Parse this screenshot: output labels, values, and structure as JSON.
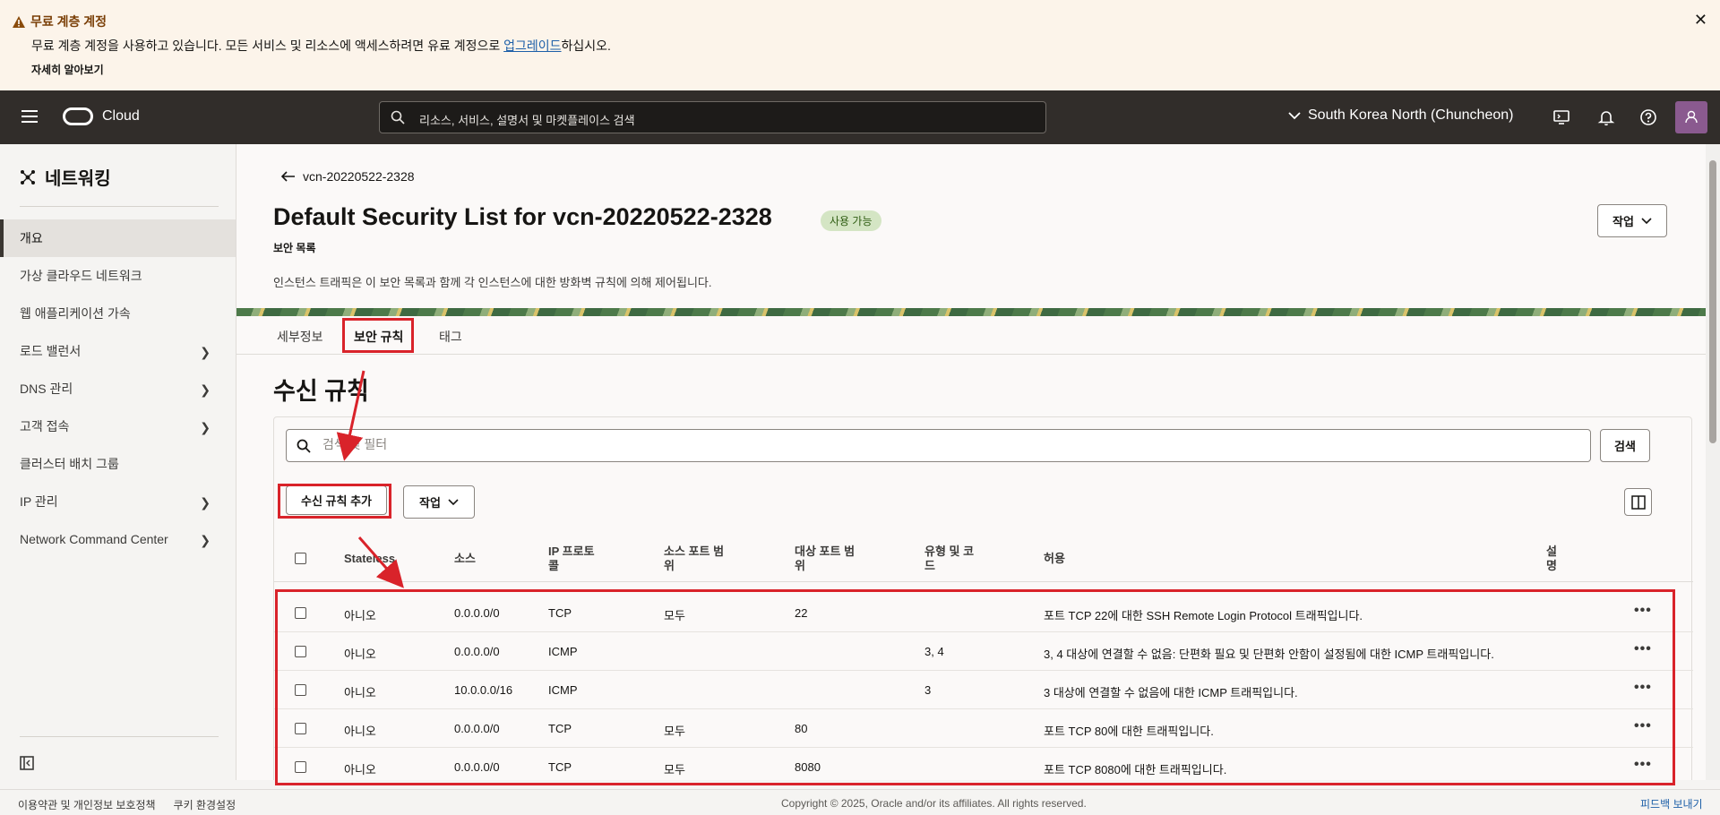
{
  "banner": {
    "title": "무료 계층 계정",
    "body_before": "무료 계층 계정을 사용하고 있습니다. 모든 서비스 및 리소스에 액세스하려면 유료 계정으로 ",
    "body_link": "업그레이드",
    "body_after": "하십시오.",
    "learn_more": "자세히 알아보기",
    "close": "✕"
  },
  "header": {
    "brand": "Cloud",
    "search_placeholder": "리소스, 서비스, 설명서 및 마켓플레이스 검색",
    "region": "South Korea North (Chuncheon)"
  },
  "sidebar": {
    "title": "네트워킹",
    "items": [
      {
        "label": "개요"
      },
      {
        "label": "가상 클라우드 네트워크"
      },
      {
        "label": "웹 애플리케이션 가속"
      },
      {
        "label": "로드 밸런서"
      },
      {
        "label": "DNS 관리"
      },
      {
        "label": "고객 접속"
      },
      {
        "label": "클러스터 배치 그룹"
      },
      {
        "label": "IP 관리"
      },
      {
        "label": "Network Command Center"
      }
    ]
  },
  "page": {
    "back_label": "vcn-20220522-2328",
    "title": "Default Security List for vcn-20220522-2328",
    "status_badge": "사용 가능",
    "subtitle": "보안 목록",
    "description": "인스턴스 트래픽은 이 보안 목록과 함께 각 인스턴스에 대한 방화벽 규칙에 의해 제어됩니다.",
    "actions_label": "작업",
    "tabs": [
      {
        "label": "세부정보"
      },
      {
        "label": "보안 규칙"
      },
      {
        "label": "태그"
      }
    ]
  },
  "ingress": {
    "title": "수신 규칙",
    "filter_placeholder": "검색 및 필터",
    "search_button": "검색",
    "add_button": "수신 규칙 추가",
    "actions_button": "작업",
    "columns": {
      "stateless": "Stateless",
      "source": "소스",
      "ip_protocol_1": "IP 프로토",
      "ip_protocol_2": "콜",
      "src_port_1": "소스 포트 범",
      "src_port_2": "위",
      "dst_port_1": "대상 포트 범",
      "dst_port_2": "위",
      "type_code_1": "유형 및 코",
      "type_code_2": "드",
      "allows": "허용",
      "desc_1": "설",
      "desc_2": "명"
    },
    "rows": [
      {
        "stateless": "아니오",
        "source": "0.0.0.0/0",
        "protocol": "TCP",
        "src_port": "모두",
        "dst_port": "22",
        "type_code": "",
        "allows": "포트 TCP 22에 대한 SSH Remote Login Protocol 트래픽입니다."
      },
      {
        "stateless": "아니오",
        "source": "0.0.0.0/0",
        "protocol": "ICMP",
        "src_port": "",
        "dst_port": "",
        "type_code": "3, 4",
        "allows": "3, 4 대상에 연결할 수 없음: 단편화 필요 및 단편화 안함이 설정됨에 대한 ICMP 트래픽입니다."
      },
      {
        "stateless": "아니오",
        "source": "10.0.0.0/16",
        "protocol": "ICMP",
        "src_port": "",
        "dst_port": "",
        "type_code": "3",
        "allows": "3 대상에 연결할 수 없음에 대한 ICMP 트래픽입니다."
      },
      {
        "stateless": "아니오",
        "source": "0.0.0.0/0",
        "protocol": "TCP",
        "src_port": "모두",
        "dst_port": "80",
        "type_code": "",
        "allows": "포트 TCP 80에 대한 트래픽입니다."
      },
      {
        "stateless": "아니오",
        "source": "0.0.0.0/0",
        "protocol": "TCP",
        "src_port": "모두",
        "dst_port": "8080",
        "type_code": "",
        "allows": "포트 TCP 8080에 대한 트래픽입니다."
      }
    ],
    "row_menu": "•••"
  },
  "footer": {
    "terms": "이용약관 및 개인정보 보호정책",
    "cookies": "쿠키 환경설정",
    "copyright": "Copyright © 2025, Oracle and/or its affiliates. All rights reserved.",
    "feedback": "피드백 보내기"
  },
  "colors": {
    "annotation_red": "#d9232a",
    "header_bg": "#312d2a",
    "banner_bg": "#fcf4ea",
    "badge_bg": "#d4e5c4"
  }
}
